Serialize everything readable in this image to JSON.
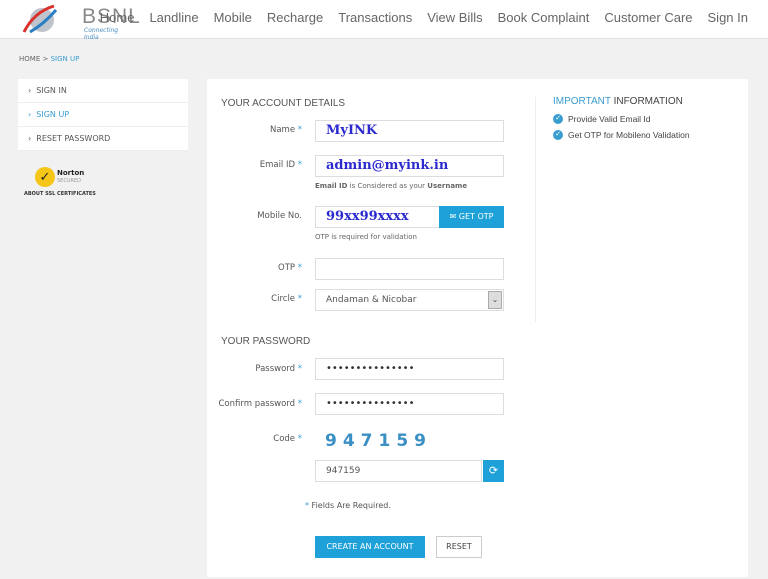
{
  "header": {
    "logo_text": "BSNL",
    "logo_tagline": "Connecting India",
    "nav": [
      "Home",
      "Landline",
      "Mobile",
      "Recharge",
      "Transactions",
      "View Bills",
      "Book Complaint",
      "Customer Care",
      "Sign In"
    ]
  },
  "breadcrumb": {
    "home": "HOME",
    "separator": ">",
    "current": "SIGN UP"
  },
  "sidebar": {
    "items": [
      {
        "label": "SIGN IN"
      },
      {
        "label": "SIGN UP",
        "active": true
      },
      {
        "label": "RESET PASSWORD"
      }
    ]
  },
  "norton": {
    "brand": "Norton",
    "sub": "SECURED",
    "caption": "ABOUT SSL CERTIFICATES"
  },
  "form": {
    "account_heading": "YOUR ACCOUNT DETAILS",
    "name_label": "Name",
    "name_value": "MyINK",
    "email_label": "Email ID",
    "email_value": "admin@myink.in",
    "email_hint_b1": "Email ID",
    "email_hint_mid": " is Considered as your ",
    "email_hint_b2": "Username",
    "mobile_label": "Mobile No.",
    "mobile_value": "99xx99xxxx",
    "get_otp": "GET OTP",
    "mobile_hint": "OTP is required for validation",
    "otp_label": "OTP",
    "otp_value": "",
    "circle_label": "Circle",
    "circle_value": "Andaman & Nicobar",
    "password_heading": "YOUR PASSWORD",
    "password_label": "Password",
    "password_value": "•••••••••••••••",
    "confirm_label": "Confirm password",
    "confirm_value": "•••••••••••••••",
    "code_label": "Code",
    "captcha": "947159",
    "code_value": "947159",
    "required_note": "Fields Are Required.",
    "required_mark": "*",
    "create_button": "CREATE AN ACCOUNT",
    "reset_button": "RESET"
  },
  "info": {
    "heading_accent": "IMPORTANT",
    "heading_rest": " INFORMATION",
    "items": [
      "Provide Valid Email Id",
      "Get OTP for Mobileno Validation"
    ]
  },
  "colors": {
    "accent": "#1ea1d9",
    "input_text": "#2a2acf"
  }
}
